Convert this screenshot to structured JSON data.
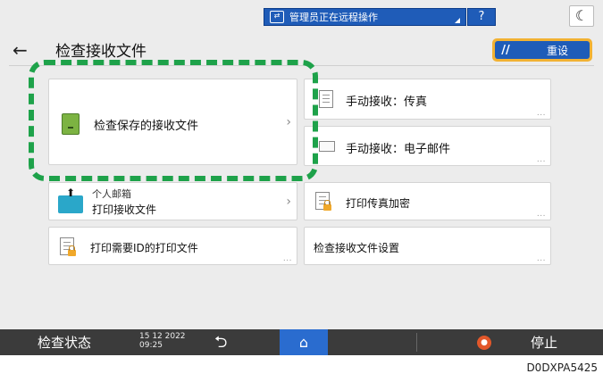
{
  "topbar": {
    "remote_text": "管理员正在远程操作",
    "help_label": "?",
    "moon_label": "☾"
  },
  "header": {
    "back_label": "←",
    "title": "检查接收文件",
    "reset_label": "重设"
  },
  "tiles": {
    "check_saved": {
      "label": "检查保存的接收文件",
      "chevron": "›"
    },
    "manual_fax": {
      "label": "手动接收：传真",
      "dots": "..."
    },
    "manual_email": {
      "label": "手动接收：电子邮件",
      "dots": "..."
    },
    "personal_box": {
      "line1": "个人邮箱",
      "line2": "打印接收文件",
      "chevron": "›"
    },
    "print_fax_enc": {
      "label": "打印传真加密",
      "dots": "..."
    },
    "print_id_files": {
      "label": "打印需要ID的打印文件",
      "dots": "..."
    },
    "receive_settings": {
      "label": "检查接收文件设置",
      "dots": "..."
    }
  },
  "bottombar": {
    "status_label": "检查状态",
    "date": "15 12 2022",
    "time": "09:25",
    "back_glyph": "⮌",
    "home_glyph": "⌂",
    "stop_label": "停止"
  },
  "figure_code": "D0DXPA5425",
  "colors": {
    "accent_blue": "#1f5cb8",
    "highlight_green": "#1ea24a",
    "reset_frame": "#f2b233",
    "bottom_bar": "#3b3b3b"
  }
}
